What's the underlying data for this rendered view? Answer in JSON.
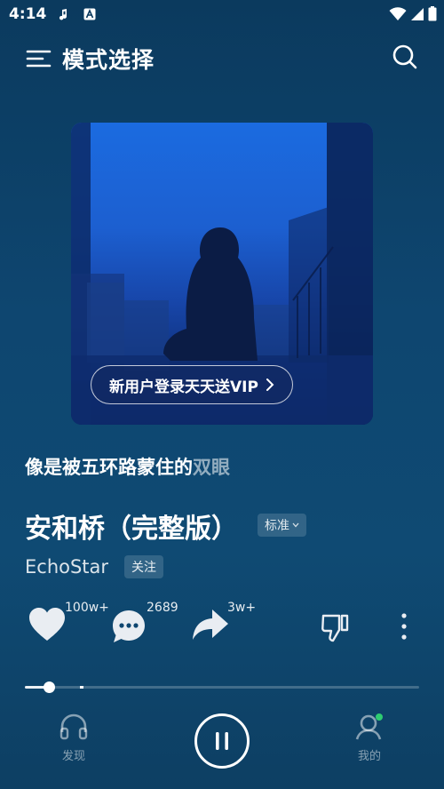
{
  "status_bar": {
    "time": "4:14",
    "icons": [
      "music-note-icon",
      "a-box-icon",
      "wifi-icon",
      "signal-icon",
      "battery-icon"
    ]
  },
  "header": {
    "title": "模式选择",
    "menu_icon": "menu-icon",
    "search_icon": "search-icon"
  },
  "cover": {
    "promo_label": "新用户登录天天送VIP",
    "promo_icon": "chevron-right-icon"
  },
  "lyric": {
    "main": "像是被五环路蒙住的",
    "fading": "双眼"
  },
  "song": {
    "title": "安和桥（完整版）",
    "quality": "标准",
    "artist": "EchoStar",
    "follow_label": "关注"
  },
  "actions": {
    "like_count": "100w+",
    "comment_count": "2689",
    "share_count": "3w+"
  },
  "progress": {
    "played_fraction": 0.06,
    "buffered_fraction": 0.145
  },
  "bottom_nav": {
    "discover_label": "发现",
    "mine_label": "我的",
    "play_state": "playing"
  },
  "colors": {
    "background": "#0e4670",
    "notification_dot": "#2ecc71"
  }
}
